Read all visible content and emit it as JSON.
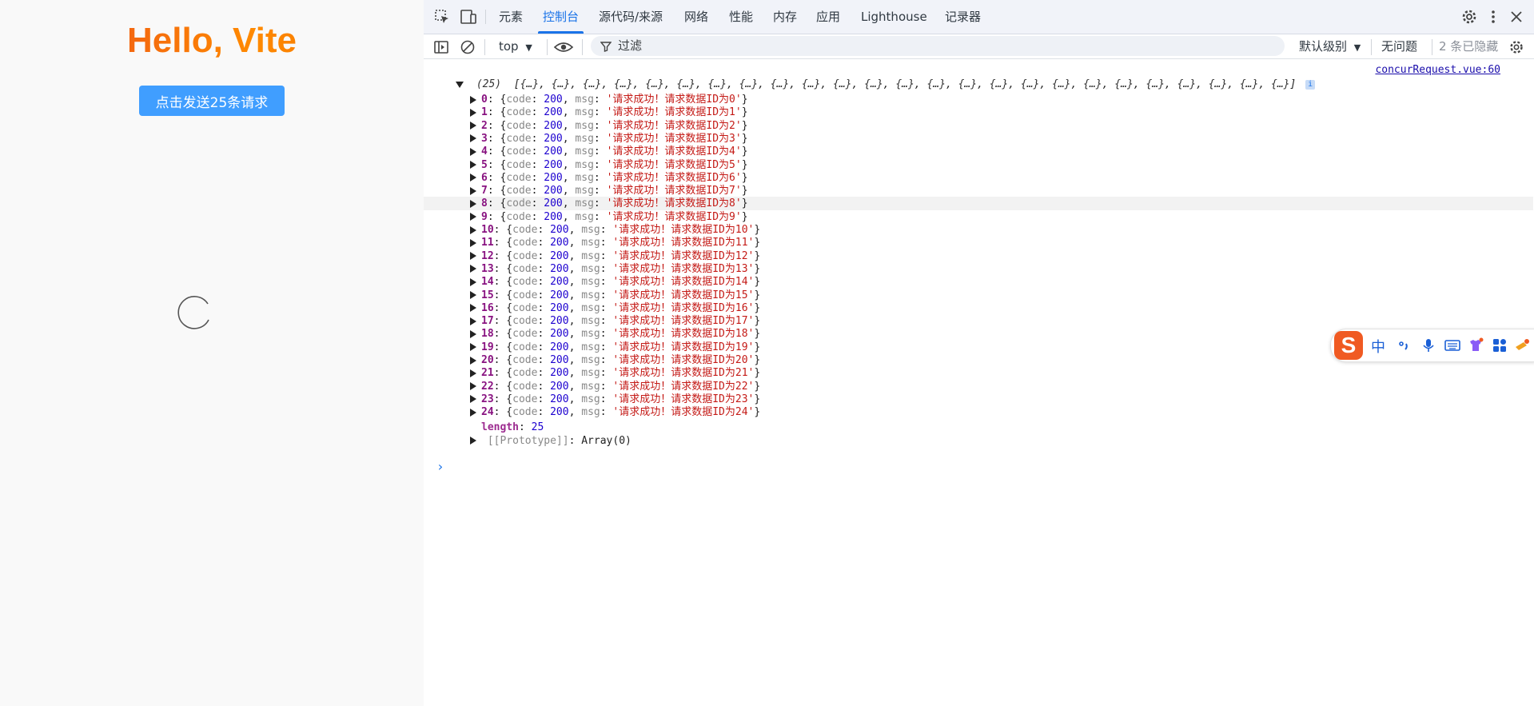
{
  "page": {
    "heading": "Hello, Vite",
    "send_button_label": "点击发送25条请求"
  },
  "devtools": {
    "tabs": [
      {
        "label": "元素"
      },
      {
        "label": "控制台"
      },
      {
        "label": "源代码/来源"
      },
      {
        "label": "网络"
      },
      {
        "label": "性能"
      },
      {
        "label": "内存"
      },
      {
        "label": "应用"
      },
      {
        "label": "Lighthouse"
      },
      {
        "label": "记录器"
      }
    ],
    "active_tab": "控制台",
    "toolbar": {
      "context": "top",
      "filter_placeholder": "过滤",
      "level_label": "默认级别",
      "issues_label": "无问题",
      "hidden_label": "2 条已隐藏"
    },
    "console": {
      "source_link": "concurRequest.vue:60",
      "summary_count": "(25)",
      "summary_item": "{…}",
      "summary_item_count": 25,
      "entry_code_key": "code",
      "entry_msg_key": "msg",
      "entries": [
        {
          "index": "0",
          "code": "200",
          "msg": "'请求成功！请求数据ID为0'"
        },
        {
          "index": "1",
          "code": "200",
          "msg": "'请求成功！请求数据ID为1'"
        },
        {
          "index": "2",
          "code": "200",
          "msg": "'请求成功！请求数据ID为2'"
        },
        {
          "index": "3",
          "code": "200",
          "msg": "'请求成功！请求数据ID为3'"
        },
        {
          "index": "4",
          "code": "200",
          "msg": "'请求成功！请求数据ID为4'"
        },
        {
          "index": "5",
          "code": "200",
          "msg": "'请求成功！请求数据ID为5'"
        },
        {
          "index": "6",
          "code": "200",
          "msg": "'请求成功！请求数据ID为6'"
        },
        {
          "index": "7",
          "code": "200",
          "msg": "'请求成功！请求数据ID为7'"
        },
        {
          "index": "8",
          "code": "200",
          "msg": "'请求成功！请求数据ID为8'"
        },
        {
          "index": "9",
          "code": "200",
          "msg": "'请求成功！请求数据ID为9'"
        },
        {
          "index": "10",
          "code": "200",
          "msg": "'请求成功！请求数据ID为10'"
        },
        {
          "index": "11",
          "code": "200",
          "msg": "'请求成功！请求数据ID为11'"
        },
        {
          "index": "12",
          "code": "200",
          "msg": "'请求成功！请求数据ID为12'"
        },
        {
          "index": "13",
          "code": "200",
          "msg": "'请求成功！请求数据ID为13'"
        },
        {
          "index": "14",
          "code": "200",
          "msg": "'请求成功！请求数据ID为14'"
        },
        {
          "index": "15",
          "code": "200",
          "msg": "'请求成功！请求数据ID为15'"
        },
        {
          "index": "16",
          "code": "200",
          "msg": "'请求成功！请求数据ID为16'"
        },
        {
          "index": "17",
          "code": "200",
          "msg": "'请求成功！请求数据ID为17'"
        },
        {
          "index": "18",
          "code": "200",
          "msg": "'请求成功！请求数据ID为18'"
        },
        {
          "index": "19",
          "code": "200",
          "msg": "'请求成功！请求数据ID为19'"
        },
        {
          "index": "20",
          "code": "200",
          "msg": "'请求成功！请求数据ID为20'"
        },
        {
          "index": "21",
          "code": "200",
          "msg": "'请求成功！请求数据ID为21'"
        },
        {
          "index": "22",
          "code": "200",
          "msg": "'请求成功！请求数据ID为22'"
        },
        {
          "index": "23",
          "code": "200",
          "msg": "'请求成功！请求数据ID为23'"
        },
        {
          "index": "24",
          "code": "200",
          "msg": "'请求成功！请求数据ID为24'"
        }
      ],
      "highlighted_index": "8",
      "length_key": "length",
      "length_value": "25",
      "prototype_key": "[[Prototype]]",
      "prototype_value": "Array(0)"
    }
  },
  "ime": {
    "logo": "S",
    "mode": "中",
    "icons": [
      "punctuation-icon",
      "microphone-icon",
      "keyboard-icon",
      "skin-icon",
      "toolbox-icon",
      "more-icon"
    ]
  },
  "colors": {
    "accent": "#1a73e8",
    "button": "#409eff",
    "index": "#881280",
    "number": "#1c00cf",
    "string": "#c41a16",
    "ime_brand": "#f05a22"
  }
}
